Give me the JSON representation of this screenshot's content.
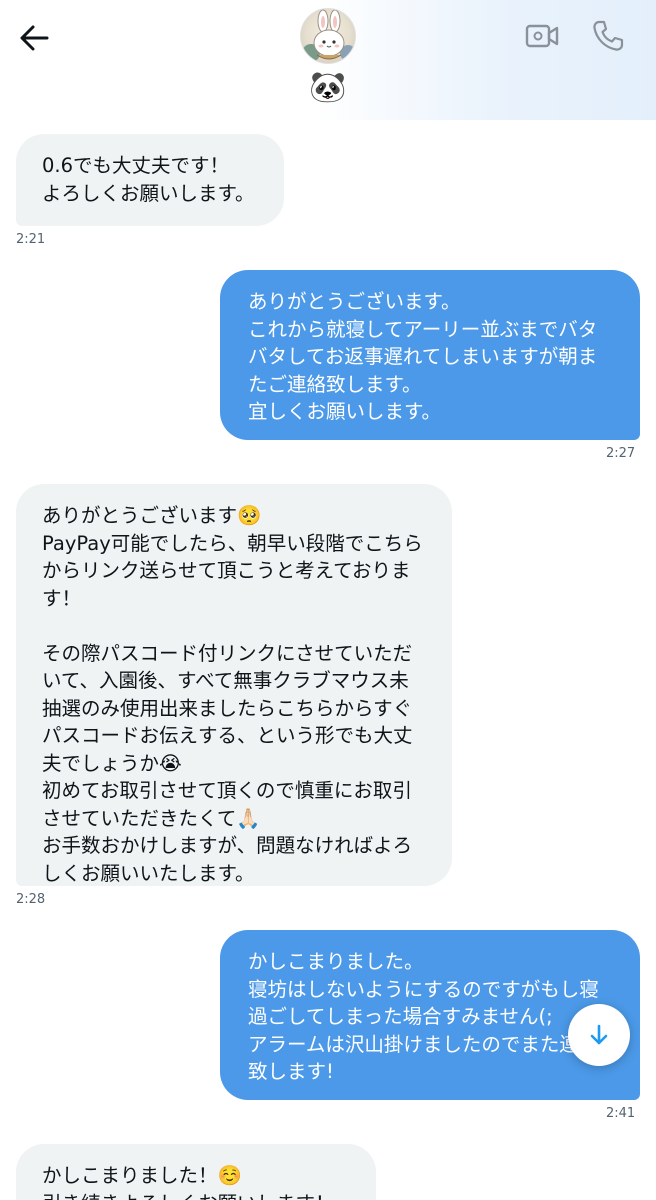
{
  "header": {
    "contact_emoji": "🐼",
    "icons": {
      "back": "arrow-left-icon",
      "video": "video-call-icon",
      "phone": "phone-icon"
    }
  },
  "messages": [
    {
      "direction": "in",
      "text": "0.6でも大丈夫です！\nよろしくお願いします。",
      "time": "2:21"
    },
    {
      "direction": "out",
      "text": "ありがとうございます。\nこれから就寝してアーリー並ぶまでバタバタしてお返事遅れてしまいますが朝またご連絡致します。\n宜しくお願いします。",
      "time": "2:27"
    },
    {
      "direction": "in",
      "text": "ありがとうございます🥺\nPayPay可能でしたら、朝早い段階でこちらからリンク送らせて頂こうと考えております！\n\nその際パスコード付リンクにさせていただいて、入園後、すべて無事クラブマウス未抽選のみ使用出来ましたらこちらからすぐパスコードお伝えする、という形でも大丈夫でしょうか😭\n初めてお取引させて頂くので慎重にお取引させていただきたくて🙏🏻\nお手数おかけしますが、問題なければよろしくお願いいたします。",
      "time": "2:28"
    },
    {
      "direction": "out",
      "text": "かしこまりました。\n寝坊はしないようにするのですがもし寝過ごしてしまった場合すみません(;\nアラームは沢山掛けましたのでまた連絡致します!",
      "time": "2:41"
    },
    {
      "direction": "in",
      "text": "かしこまりました！☺️\n引き続きよろしくお願いします！",
      "time": ""
    }
  ],
  "scroll_button": {
    "icon": "arrow-down-icon"
  },
  "colors": {
    "outgoing_bubble": "#4b99e8",
    "incoming_bubble": "#eff3f4",
    "timestamp": "#536471",
    "accent": "#1d9bf0"
  }
}
